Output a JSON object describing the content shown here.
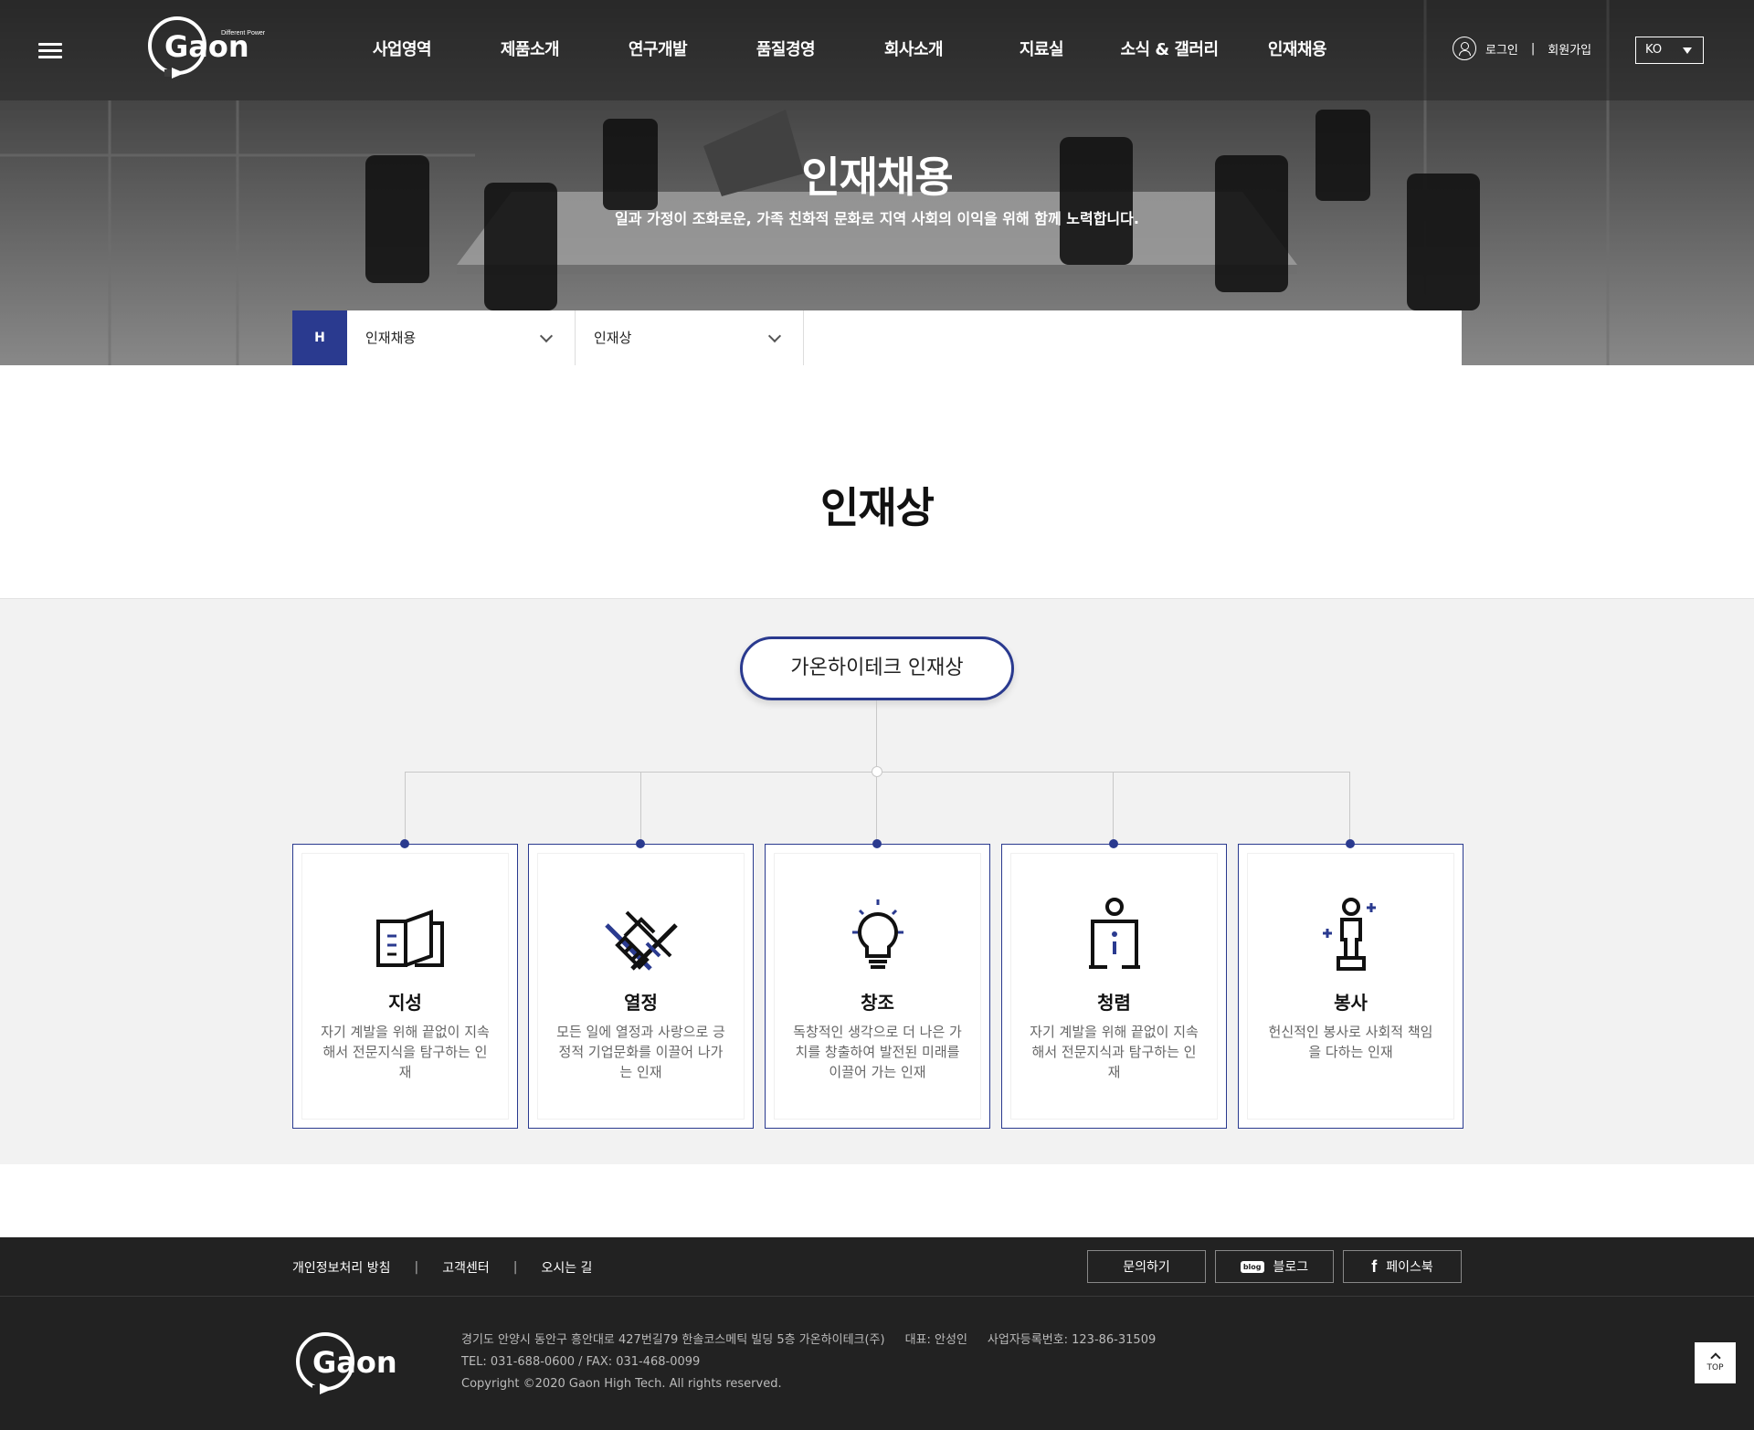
{
  "header": {
    "logo_text": "Gaon",
    "logo_tagline": "Different Power",
    "nav": [
      "사업영역",
      "제품소개",
      "연구개발",
      "품질경영",
      "회사소개",
      "지료실",
      "소식 & 갤러리",
      "인재채용"
    ],
    "login": "로그인",
    "separator": "|",
    "signup": "회원가입",
    "lang": "KO"
  },
  "hero": {
    "title": "인재채용",
    "subtitle": "일과 가정이 조화로운, 가족 친화적 문화로 지역 사회의 이익을 위해 함께 노력합니다."
  },
  "location": {
    "home": "H",
    "menu1": "인재채용",
    "menu2": "인재상"
  },
  "section": {
    "title": "인재상",
    "pill": "가온하이테크 인재상"
  },
  "cards": [
    {
      "title": "지성",
      "desc": "자기 계발을 위해 끝없이 지속해서 전문지식을 탐구하는 인재",
      "icon": "book-icon"
    },
    {
      "title": "열정",
      "desc": "모든 일에 열정과 사랑으로 긍정적 기업문화를 이끌어 나가는 인재",
      "icon": "handshake-icon"
    },
    {
      "title": "창조",
      "desc": "독창적인 생각으로 더 나은 가치를 창출하여 발전된 미래를 이끌어 가는 인재",
      "icon": "lightbulb-icon"
    },
    {
      "title": "청렴",
      "desc": "자기 계발을 위해 끝없이 지속해서 전문지식과 탐구하는 인재",
      "icon": "info-person-icon"
    },
    {
      "title": "봉사",
      "desc": "헌신적인 봉사로 사회적 책임을 다하는 인재",
      "icon": "trophy-person-icon"
    }
  ],
  "footer": {
    "links": [
      "개인정보처리 방침",
      "고객센터",
      "오시는 길"
    ],
    "separator": "|",
    "btn_contact": "문의하기",
    "btn_blog": "블로그",
    "blog_icon_text": "blog",
    "btn_facebook": "페이스북",
    "facebook_icon_text": "f",
    "address": "경기도 안양시 동안구 흥안대로 427번길79 한솔코스메틱 빌딩 5층 가온하이테크(주)",
    "ceo": "대표: 안성인",
    "bizno": "사업자등록번호: 123-86-31509",
    "tel": "TEL: 031-688-0600 / FAX: 031-468-0099",
    "copyright": "Copyright ©2020 Gaon High Tech. All rights reserved.",
    "top": "TOP"
  },
  "colors": {
    "accent": "#2a3a8f",
    "footer_bg": "#222222",
    "gray_bg": "#f2f2f2"
  }
}
